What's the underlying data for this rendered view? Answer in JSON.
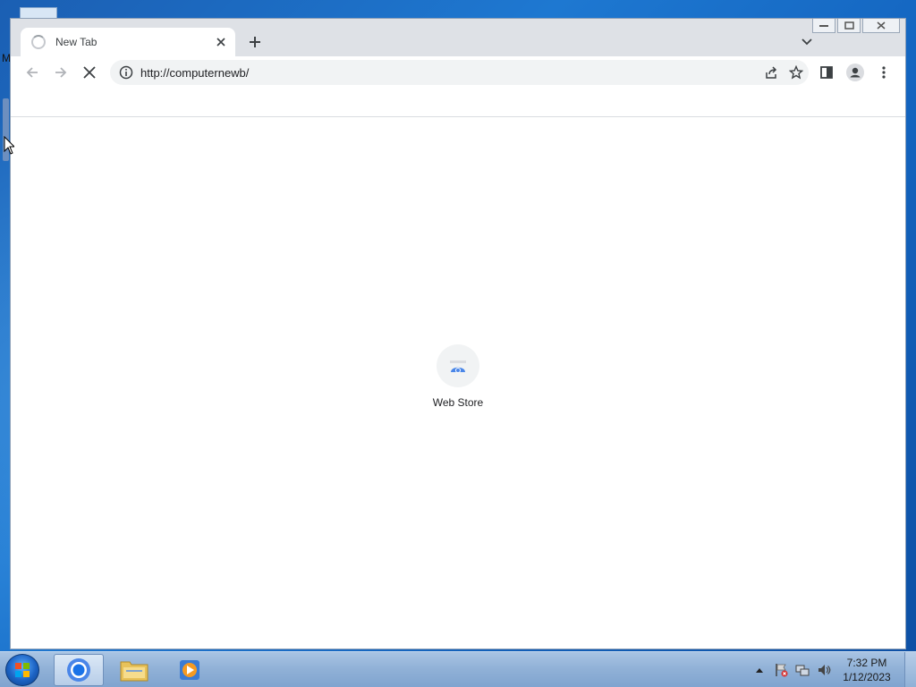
{
  "desktop": {
    "partial_label": "M"
  },
  "browser": {
    "tab": {
      "title": "New Tab"
    },
    "address": {
      "url": "http://computernewb/"
    },
    "shortcut": {
      "label": "Web Store"
    }
  },
  "taskbar": {
    "clock": {
      "time": "7:32 PM",
      "date": "1/12/2023"
    }
  },
  "colors": {
    "accent": "#1a73e8",
    "taskbar": "#8fb0d6"
  }
}
